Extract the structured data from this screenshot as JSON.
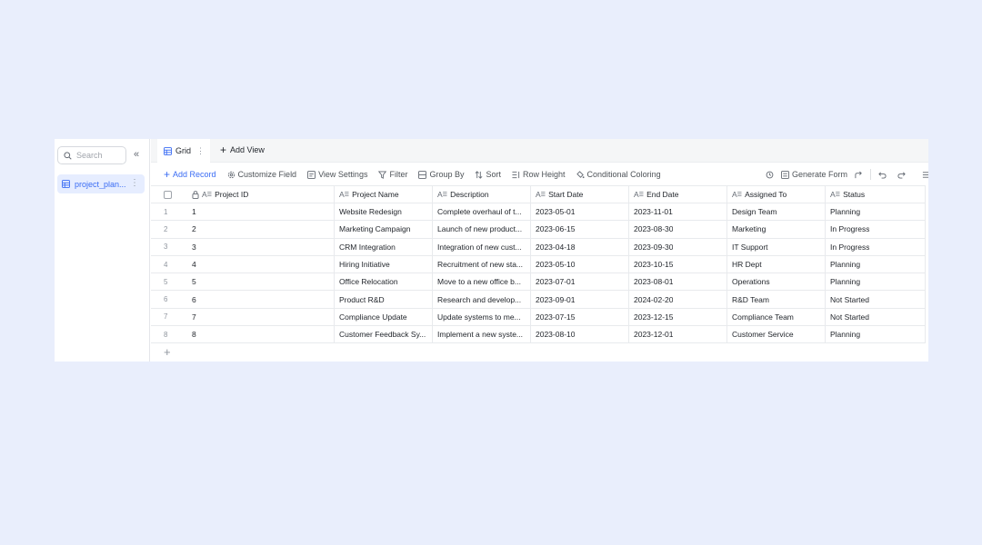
{
  "sidebar": {
    "search_placeholder": "Search",
    "collapse_symbol": "«",
    "tables": [
      {
        "label": "project_plan..."
      }
    ]
  },
  "tabs": {
    "active": {
      "label": "Grid"
    },
    "add_view_label": "Add View"
  },
  "toolbar": {
    "add_record": "Add Record",
    "customize_field": "Customize Field",
    "view_settings": "View Settings",
    "filter": "Filter",
    "group_by": "Group By",
    "sort": "Sort",
    "row_height": "Row Height",
    "conditional_coloring": "Conditional Coloring",
    "generate_form": "Generate Form"
  },
  "grid": {
    "columns": [
      "Project ID",
      "Project Name",
      "Description",
      "Start Date",
      "End Date",
      "Assigned To",
      "Status"
    ],
    "rows": [
      {
        "index": "1",
        "cells": [
          "1",
          "Website Redesign",
          "Complete overhaul of t...",
          "2023-05-01",
          "2023-11-01",
          "Design Team",
          "Planning"
        ]
      },
      {
        "index": "2",
        "cells": [
          "2",
          "Marketing Campaign",
          "Launch of new product...",
          "2023-06-15",
          "2023-08-30",
          "Marketing",
          "In Progress"
        ]
      },
      {
        "index": "3",
        "cells": [
          "3",
          "CRM Integration",
          "Integration of new cust...",
          "2023-04-18",
          "2023-09-30",
          "IT Support",
          "In Progress"
        ]
      },
      {
        "index": "4",
        "cells": [
          "4",
          "Hiring Initiative",
          "Recruitment of new sta...",
          "2023-05-10",
          "2023-10-15",
          "HR Dept",
          "Planning"
        ]
      },
      {
        "index": "5",
        "cells": [
          "5",
          "Office Relocation",
          "Move to a new office b...",
          "2023-07-01",
          "2023-08-01",
          "Operations",
          "Planning"
        ]
      },
      {
        "index": "6",
        "cells": [
          "6",
          "Product R&D",
          "Research and develop...",
          "2023-09-01",
          "2024-02-20",
          "R&D Team",
          "Not Started"
        ]
      },
      {
        "index": "7",
        "cells": [
          "7",
          "Compliance Update",
          "Update systems to me...",
          "2023-07-15",
          "2023-12-15",
          "Compliance Team",
          "Not Started"
        ]
      },
      {
        "index": "8",
        "cells": [
          "8",
          "Customer Feedback Sy...",
          "Implement a new syste...",
          "2023-08-10",
          "2023-12-01",
          "Customer Service",
          "Planning"
        ]
      }
    ],
    "add_row_symbol": "+"
  },
  "colors": {
    "accent": "#3a6cf4",
    "background": "#e9eefc",
    "selected_bg": "#e6edff"
  }
}
